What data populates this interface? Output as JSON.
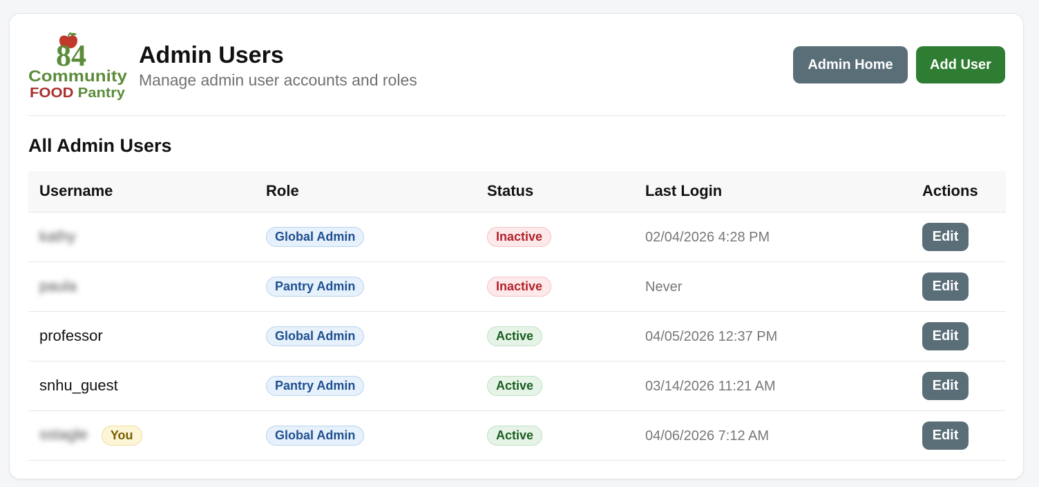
{
  "brand": {
    "logo_number": "84",
    "logo_line1": "Community",
    "logo_line2_a": "FOOD",
    "logo_line2_b": "Pantry",
    "colors": {
      "green": "#5b8c3a",
      "red": "#a8302f"
    }
  },
  "header": {
    "title": "Admin Users",
    "subtitle": "Manage admin user accounts and roles",
    "admin_home_label": "Admin Home",
    "add_user_label": "Add User"
  },
  "section": {
    "title": "All Admin Users"
  },
  "table": {
    "columns": {
      "username": "Username",
      "role": "Role",
      "status": "Status",
      "last_login": "Last Login",
      "actions": "Actions"
    },
    "rows": [
      {
        "username": "kathy",
        "blurred": true,
        "you": "",
        "role": "Global Admin",
        "status": "Inactive",
        "last_login": "02/04/2026 4:28 PM",
        "action": "Edit"
      },
      {
        "username": "paula",
        "blurred": true,
        "you": "",
        "role": "Pantry Admin",
        "status": "Inactive",
        "last_login": "Never",
        "action": "Edit"
      },
      {
        "username": "professor",
        "blurred": false,
        "you": "",
        "role": "Global Admin",
        "status": "Active",
        "last_login": "04/05/2026 12:37 PM",
        "action": "Edit"
      },
      {
        "username": "snhu_guest",
        "blurred": false,
        "you": "",
        "role": "Pantry Admin",
        "status": "Active",
        "last_login": "03/14/2026 11:21 AM",
        "action": "Edit"
      },
      {
        "username": "sstagle",
        "blurred": true,
        "you": "You",
        "role": "Global Admin",
        "status": "Active",
        "last_login": "04/06/2026 7:12 AM",
        "action": "Edit"
      }
    ]
  },
  "colors": {
    "primary_green": "#2e7d32",
    "slate": "#5a6e78",
    "active": "#1b5e20",
    "inactive": "#b3222b",
    "role_blue": "#1f4f8f"
  }
}
